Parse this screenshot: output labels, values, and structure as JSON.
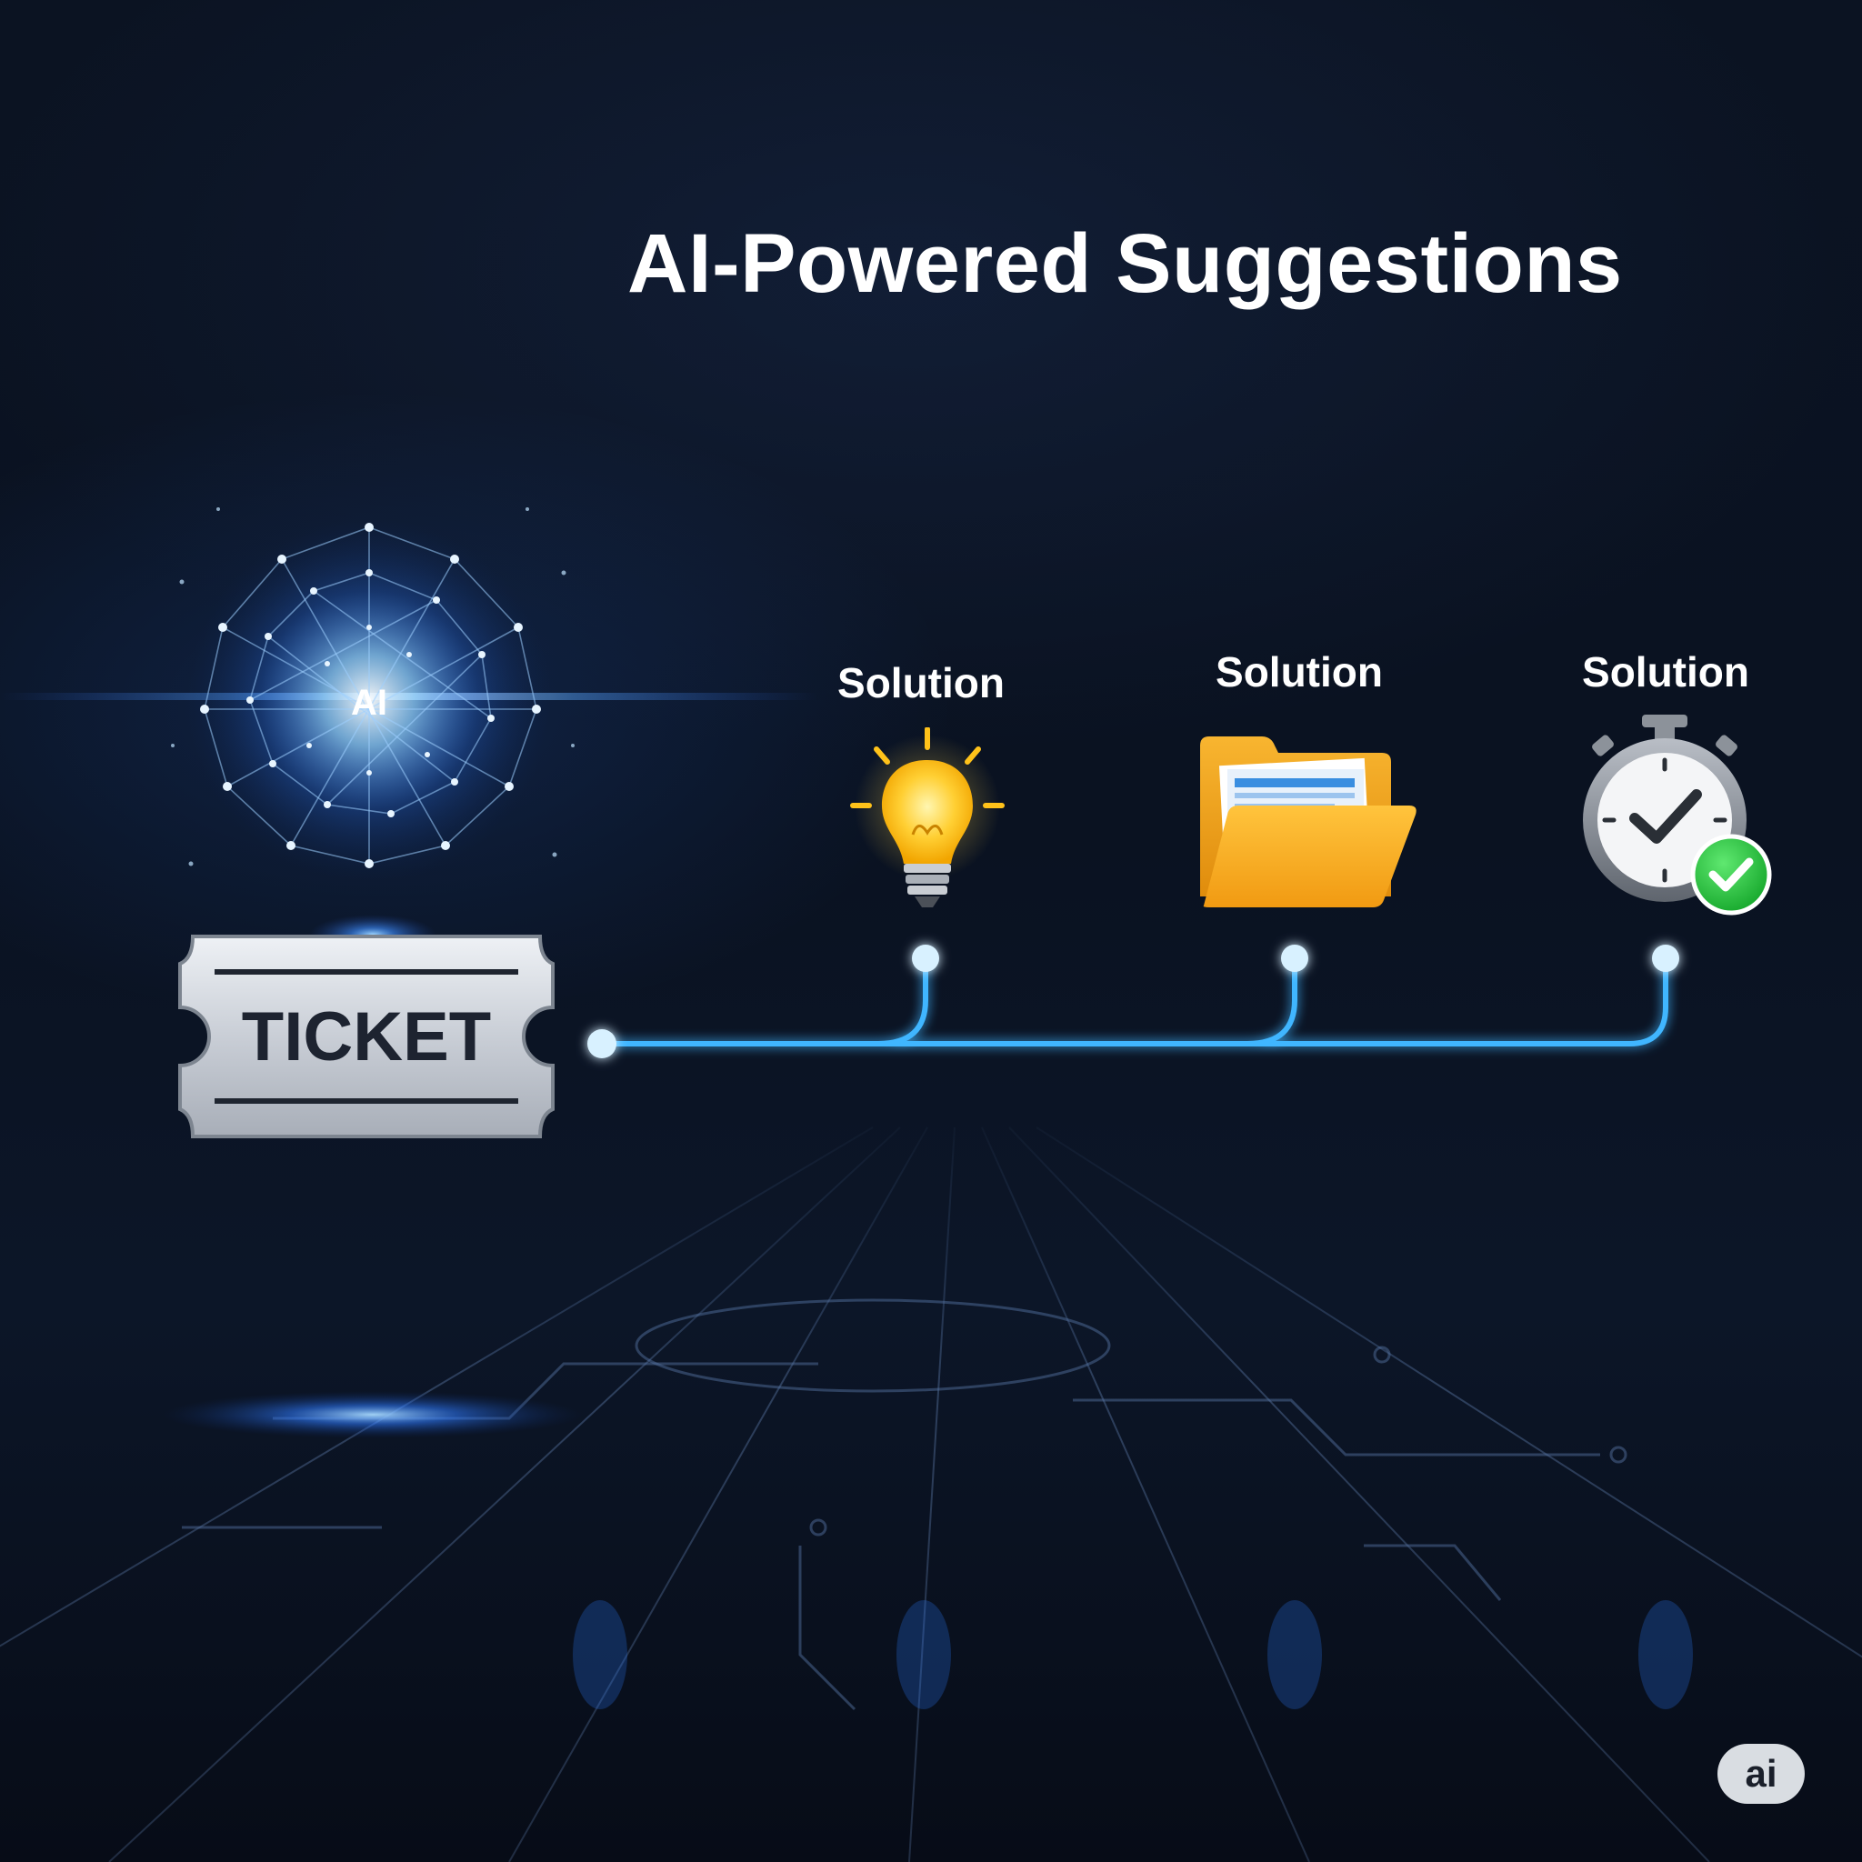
{
  "title": "AI-Powered Suggestions",
  "core": {
    "label": "AI"
  },
  "ticket": {
    "label": "TICKET"
  },
  "solutions": [
    {
      "label": "Solution",
      "icon": "lightbulb-icon"
    },
    {
      "label": "Solution",
      "icon": "folder-icon"
    },
    {
      "label": "Solution",
      "icon": "stopwatch-check-icon"
    }
  ],
  "watermark": "ai",
  "colors": {
    "background": "#0a1221",
    "connector": "#3fb6ff",
    "bulb": "#ffcc33",
    "folder": "#f5a623",
    "check": "#2ecc40"
  }
}
